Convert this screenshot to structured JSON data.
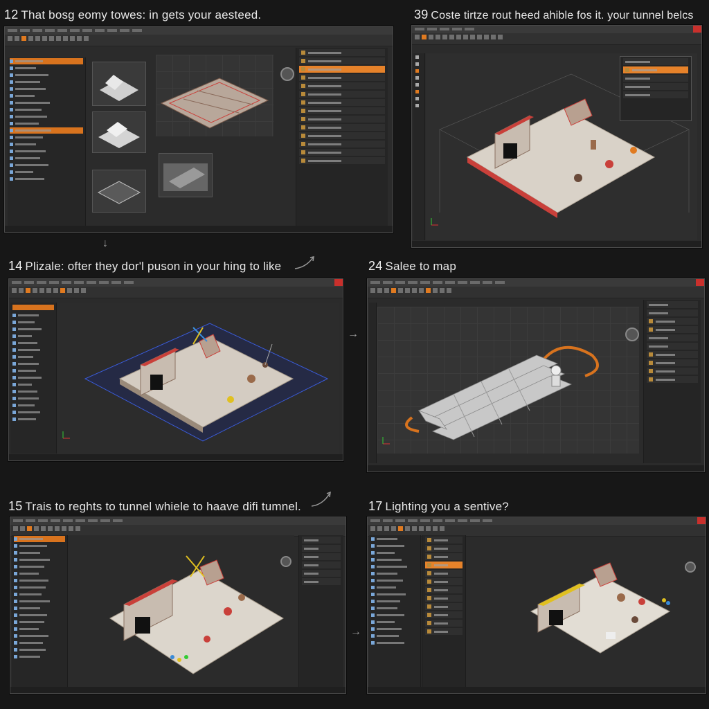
{
  "captions": {
    "p1": {
      "num": "12",
      "text": "That bosg eomy towes: in gets your aesteed."
    },
    "p2": {
      "num": "39",
      "text": "Coste tirtze rout heed ahible fos it. your tunnel belcs"
    },
    "p3": {
      "num": "14",
      "text": "Plizale: ofter they dor'l puson in your hing to like"
    },
    "p4": {
      "num": "24",
      "text": "Saleе to map"
    },
    "p5": {
      "num": "15",
      "text": "Trais to reghts to tunnel whiele to haave difi tumnel."
    },
    "p6": {
      "num": "17",
      "text": "Lighting you a sentive?"
    }
  },
  "icons": {
    "close": "close-icon",
    "gizmo": "view-gizmo-icon",
    "axis": "axis-icon",
    "arrow": "arrow-right-icon"
  },
  "colors": {
    "accent": "#e07a20",
    "close": "#c9302c",
    "model_wall": "#d8cfc4",
    "model_red": "#c9403a",
    "selection_blue": "#3a5bd8"
  }
}
